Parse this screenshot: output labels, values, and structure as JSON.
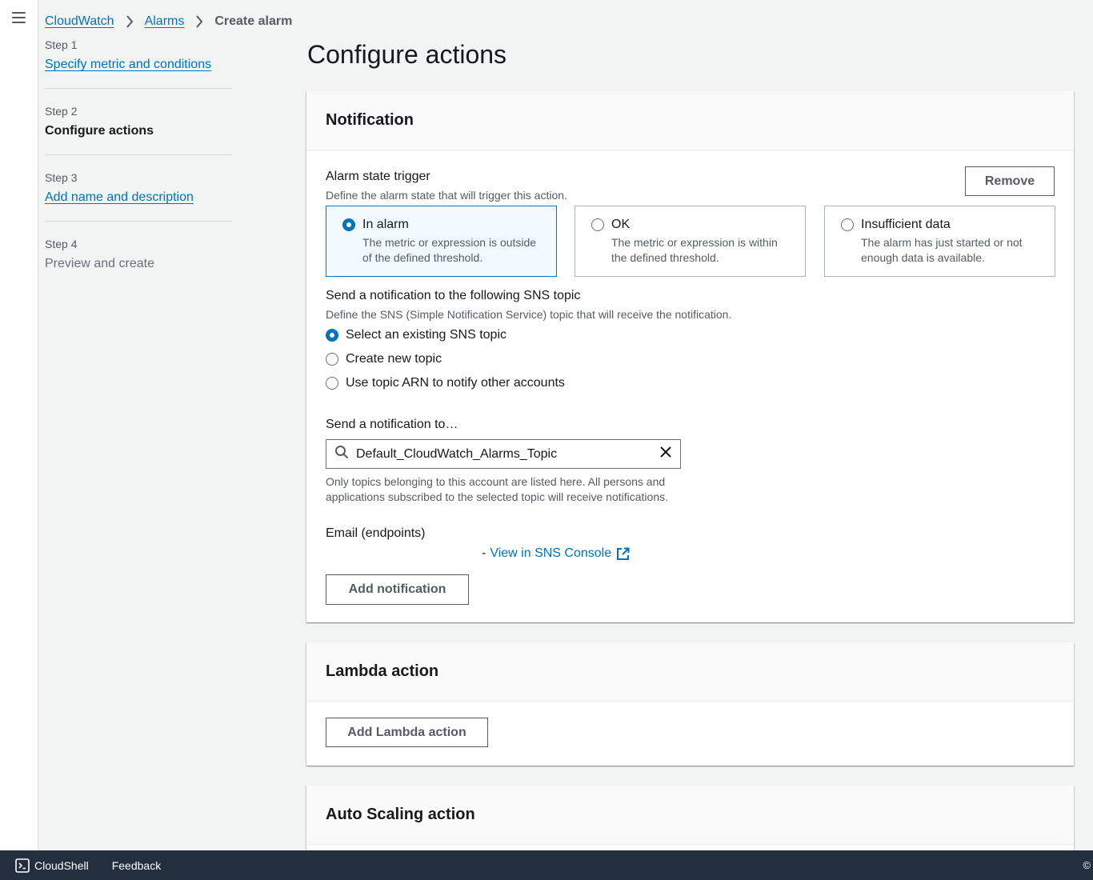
{
  "breadcrumb": {
    "items": [
      "CloudWatch",
      "Alarms"
    ],
    "current": "Create alarm"
  },
  "steps": [
    {
      "num": "Step 1",
      "label": "Specify metric and conditions",
      "state": "link"
    },
    {
      "num": "Step 2",
      "label": "Configure actions",
      "state": "current"
    },
    {
      "num": "Step 3",
      "label": "Add name and description",
      "state": "link"
    },
    {
      "num": "Step 4",
      "label": "Preview and create",
      "state": "disabled"
    }
  ],
  "page_title": "Configure actions",
  "notification": {
    "title": "Notification",
    "trigger_label": "Alarm state trigger",
    "trigger_desc": "Define the alarm state that will trigger this action.",
    "remove_label": "Remove",
    "tiles": [
      {
        "title": "In alarm",
        "desc": "The metric or expression is outside of the defined threshold.",
        "selected": true
      },
      {
        "title": "OK",
        "desc": "The metric or expression is within the defined threshold.",
        "selected": false
      },
      {
        "title": "Insufficient data",
        "desc": "The alarm has just started or not enough data is available.",
        "selected": false
      }
    ],
    "sns_label": "Send a notification to the following SNS topic",
    "sns_desc": "Define the SNS (Simple Notification Service) topic that will receive the notification.",
    "sns_options": [
      {
        "label": "Select an existing SNS topic",
        "selected": true
      },
      {
        "label": "Create new topic",
        "selected": false
      },
      {
        "label": "Use topic ARN to notify other accounts",
        "selected": false
      }
    ],
    "send_to_label": "Send a notification to…",
    "search_value": "Default_CloudWatch_Alarms_Topic",
    "hint_line1": "Only topics belonging to this account are listed here. All persons and",
    "hint_line2": "applications subscribed to the selected topic will receive notifications.",
    "email_label": "Email (endpoints)",
    "dash": "-",
    "sns_console_link": "View in SNS Console",
    "add_notification_label": "Add notification"
  },
  "lambda": {
    "title": "Lambda action",
    "add_label": "Add Lambda action"
  },
  "autoscaling": {
    "title": "Auto Scaling action"
  },
  "footer": {
    "cloudshell": "CloudShell",
    "feedback": "Feedback",
    "copyright": "©"
  },
  "colors": {
    "link": "#0073bb",
    "selected_bg": "#f1faff",
    "footer_bg": "#232f3e"
  }
}
